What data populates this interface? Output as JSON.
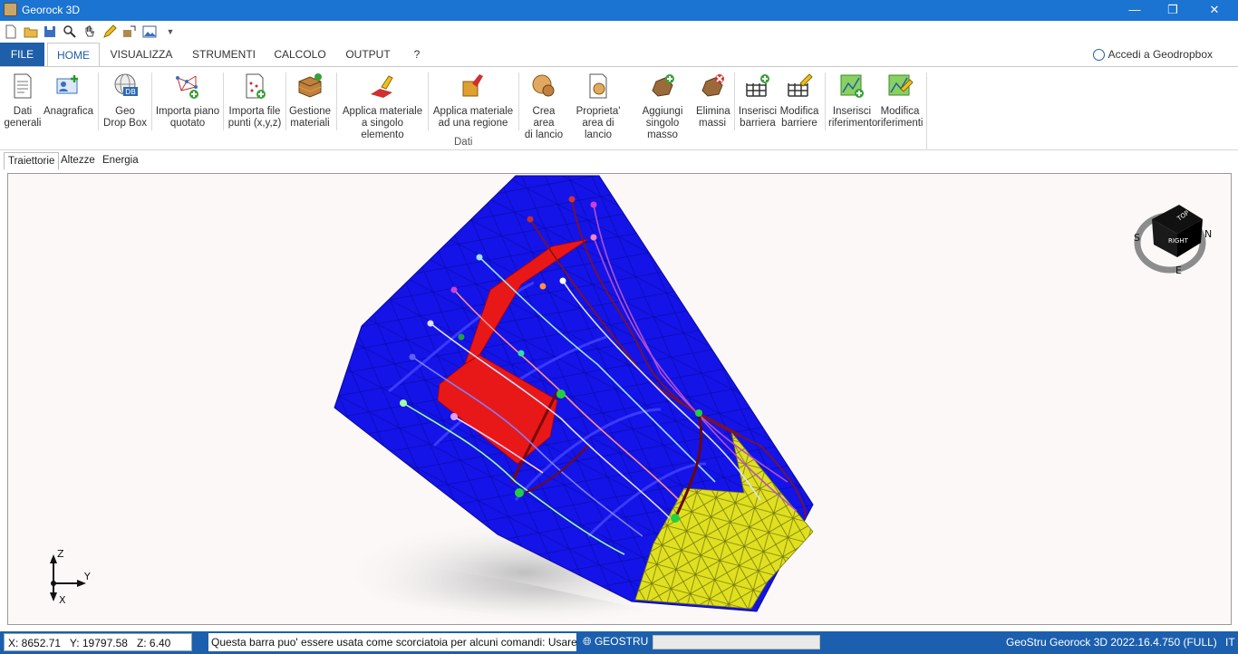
{
  "window": {
    "title": "Georock 3D",
    "controls": {
      "minimize": "—",
      "restore": "❐",
      "close": "✕"
    }
  },
  "quick_access": [
    "new-icon",
    "open-icon",
    "save-icon",
    "zoom-icon",
    "pan-icon",
    "pencil-icon",
    "image-import-icon",
    "picture-icon",
    "dropdown-icon"
  ],
  "ribbon_tabs": [
    "FILE",
    "HOME",
    "VISUALIZZA",
    "STRUMENTI",
    "CALCOLO",
    "OUTPUT",
    "?"
  ],
  "login_label": "Accedi a Geodropbox",
  "ribbon_buttons": [
    {
      "l1": "Dati",
      "l2": "generali",
      "icon": "document-icon"
    },
    {
      "l1": "Anagrafica",
      "l2": "",
      "icon": "id-card-icon"
    },
    {
      "l1": "Geo",
      "l2": "Drop Box",
      "icon": "geodropbox-globe-icon"
    },
    {
      "l1": "Importa piano",
      "l2": "quotato",
      "icon": "import-elevation-icon"
    },
    {
      "l1": "Importa file",
      "l2": "punti (x,y,z)",
      "icon": "import-points-icon"
    },
    {
      "l1": "Gestione",
      "l2": "materiali",
      "icon": "materials-icon"
    },
    {
      "l1": "Applica materiale",
      "l2": "a singolo elemento",
      "icon": "paint-element-icon"
    },
    {
      "l1": "Applica materiale",
      "l2": "ad una regione",
      "icon": "paint-region-icon"
    },
    {
      "l1": "Crea area",
      "l2": "di lancio",
      "icon": "launch-area-icon"
    },
    {
      "l1": "Proprieta'",
      "l2": "area di lancio",
      "icon": "launch-properties-icon"
    },
    {
      "l1": "Aggiungi",
      "l2": "singolo masso",
      "icon": "add-boulder-icon"
    },
    {
      "l1": "Elimina",
      "l2": "massi",
      "icon": "delete-boulders-icon"
    },
    {
      "l1": "Inserisci",
      "l2": "barriera",
      "icon": "insert-barrier-icon"
    },
    {
      "l1": "Modifica",
      "l2": "barriere",
      "icon": "edit-barrier-icon"
    },
    {
      "l1": "Inserisci",
      "l2": "riferimento",
      "icon": "insert-reference-icon"
    },
    {
      "l1": "Modifica",
      "l2": "riferimenti",
      "icon": "edit-reference-icon"
    }
  ],
  "ribbon_group_label": "Dati",
  "view_tabs": [
    "Traiettorie",
    "Altezze",
    "Energia"
  ],
  "viewcube": {
    "top": "TOP",
    "front": "RIGHT",
    "s": "S",
    "n": "N",
    "e": "E"
  },
  "axes": {
    "z": "Z",
    "y": "Y",
    "x": "X"
  },
  "status": {
    "x": "X: 8652.71",
    "y": "Y: 19797.58",
    "z": "Z: 6.40",
    "command_hint": "Questa barra puo' essere usata come scorciatoia per alcuni comandi: Usare le stesse",
    "brand": "GEOSTRU",
    "version": "GeoStru Georock 3D 2022.16.4.750 (FULL)",
    "language": "IT"
  },
  "colors": {
    "titlebar": "#1b73d2",
    "statusbar": "#1b5fae",
    "terrain": "#1414e8",
    "barrier": "#e81818",
    "deposit": "#e0e020",
    "trajectory_red": "#8b1010",
    "trajectory_violet": "#b050d0",
    "trajectory_cyan": "#a0e0f0"
  }
}
